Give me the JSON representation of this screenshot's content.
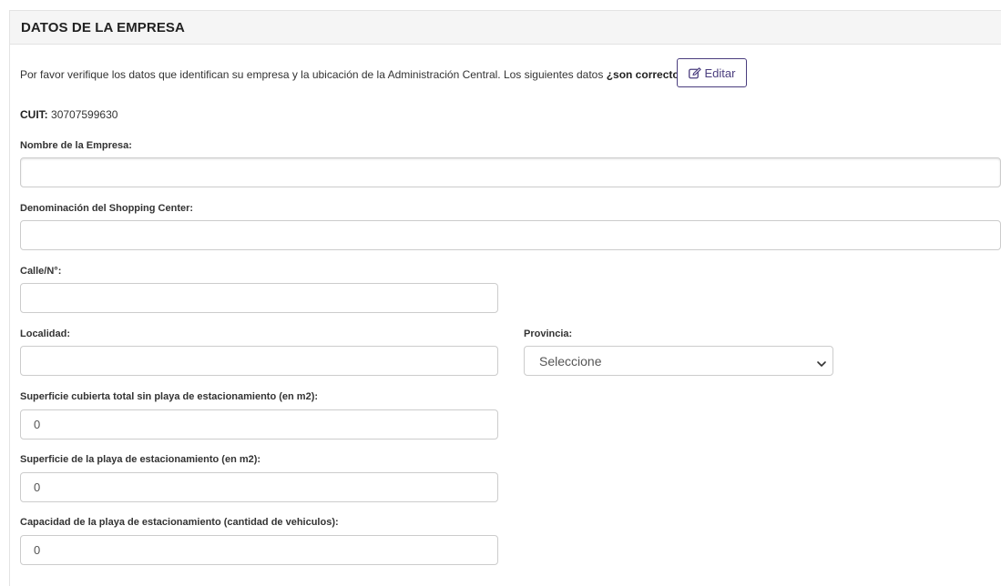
{
  "panel": {
    "title": "DATOS DE LA EMPRESA"
  },
  "intro": {
    "text": "Por favor verifique los datos que identifican su empresa y la ubicación de la Administración Central. Los siguientes datos ",
    "question": "¿son correctos?",
    "edit_label": "Editar",
    "edit_icon": "edit-icon"
  },
  "cuit": {
    "label": "CUIT:",
    "value": "30707599630"
  },
  "fields": {
    "nombre_empresa": {
      "label": "Nombre de la Empresa:",
      "value": ""
    },
    "denominacion": {
      "label": "Denominación del Shopping Center:",
      "value": ""
    },
    "calle": {
      "label": "Calle/N°:",
      "value": ""
    },
    "localidad": {
      "label": "Localidad:",
      "value": ""
    },
    "provincia": {
      "label": "Provincia:",
      "selected": "Seleccione"
    },
    "superficie_cubierta": {
      "label": "Superficie cubierta total sin playa de estacionamiento (en m2):",
      "value": "0"
    },
    "superficie_playa": {
      "label": "Superficie de la playa de estacionamiento (en m2):",
      "value": "0"
    },
    "capacidad_playa": {
      "label": "Capacidad de la playa de estacionamiento (cantidad de vehiculos):",
      "value": "0"
    }
  },
  "colors": {
    "accent": "#4a3d7e",
    "border": "#cccccc",
    "heading_bg": "#f5f5f5"
  }
}
